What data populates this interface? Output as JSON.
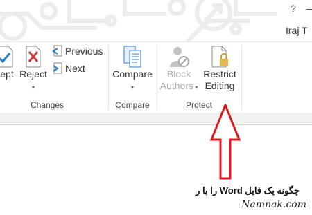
{
  "titlebar": {
    "help_label": "?",
    "user_name": "Iraj T"
  },
  "ribbon": {
    "changes": {
      "accept_label": "ept",
      "reject_label": "Reject",
      "previous_label": "Previous",
      "next_label": "Next",
      "group_label": "Changes"
    },
    "compare": {
      "compare_label": "Compare",
      "group_label": "Compare"
    },
    "protect": {
      "block_authors_line1": "Block",
      "block_authors_line2": "Authors",
      "restrict_editing_line1": "Restrict",
      "restrict_editing_line2": "Editing",
      "group_label": "Protect"
    }
  },
  "document": {
    "text_line": "چگونه یک فایل Word را با ر"
  },
  "watermark": "Namnak.com",
  "colors": {
    "arrow": "#e0161d",
    "reject_x": "#d13438",
    "icon_blue": "#2b7cd3",
    "disabled": "#a9a9a9",
    "lock": "#e8b84a"
  }
}
